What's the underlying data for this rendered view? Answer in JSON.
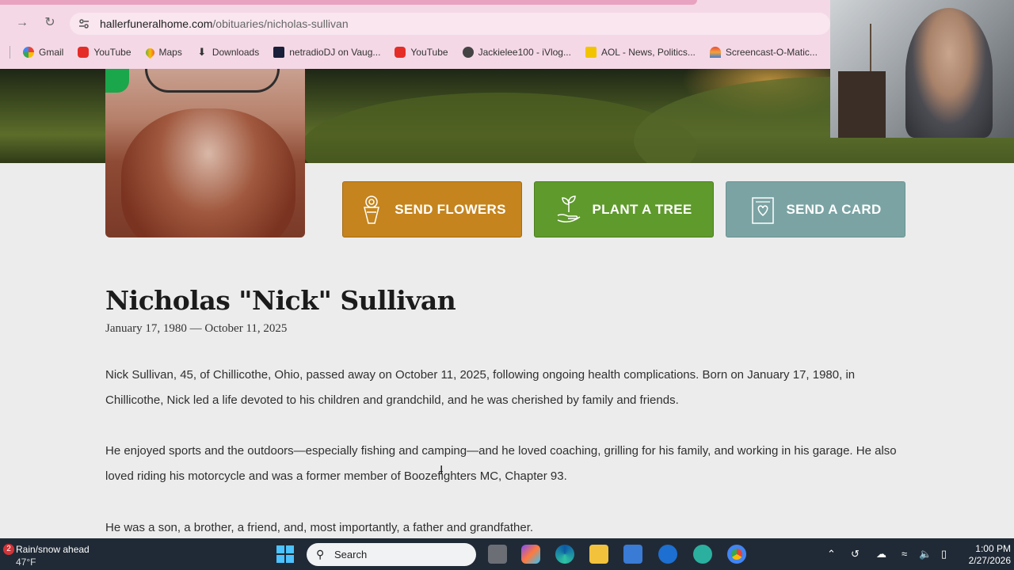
{
  "browser": {
    "url_host": "hallerfuneralhome.com",
    "url_path": "/obituaries/nicholas-sullivan",
    "bookmarks": [
      "Gmail",
      "YouTube",
      "Maps",
      "Downloads",
      "netradioDJ on Vaug...",
      "YouTube",
      "Jackielee100 - iVlog...",
      "AOL - News, Politics...",
      "Screencast-O-Matic..."
    ]
  },
  "actions": {
    "flowers": "SEND FLOWERS",
    "tree": "PLANT A TREE",
    "card": "SEND A CARD"
  },
  "obituary": {
    "name": "Nicholas \"Nick\" Sullivan",
    "dates": "January 17, 1980 — October 11, 2025",
    "paragraphs": [
      "Nick Sullivan, 45, of Chillicothe, Ohio, passed away on October 11, 2025, following ongoing health complications. Born on January 17, 1980, in Chillicothe, Nick led a life devoted to his children and grandchild, and he was cherished by family and friends.",
      "He enjoyed sports and the outdoors—especially fishing and camping—and he loved coaching, grilling for his family, and working in his garage. He also loved riding his motorcycle and was a former member of Boozefighters MC, Chapter 93.",
      "He was a son, a brother, a friend, and, most importantly, a father and grandfather."
    ]
  },
  "taskbar": {
    "weather_badge": "2",
    "weather_line1": "Rain/snow ahead",
    "weather_line2": "47°F",
    "search_placeholder": "Search",
    "time": "1:00 PM",
    "date": "2/27/2026"
  },
  "colors": {
    "flowers_btn": "#c5841d",
    "tree_btn": "#5f9a2c",
    "card_btn": "#7ba3a3"
  }
}
